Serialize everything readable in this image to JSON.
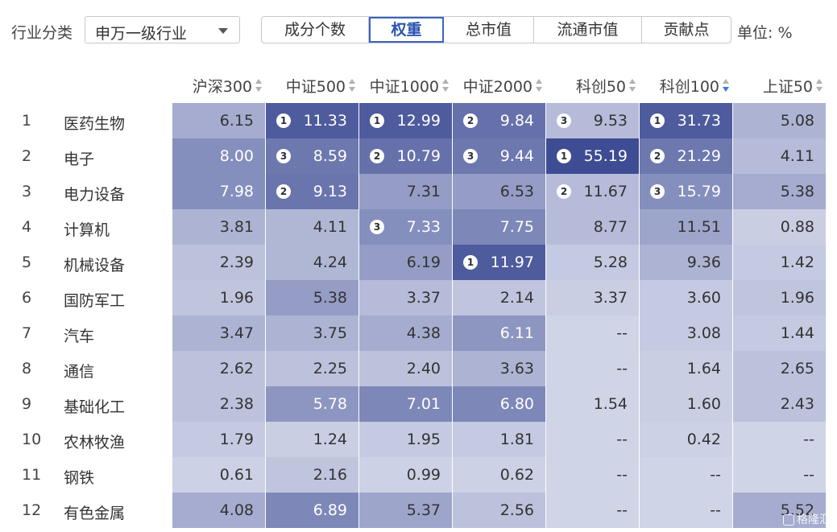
{
  "toolbar": {
    "industry_label": "行业分类",
    "industry_select": "申万一级行业",
    "tabs": [
      {
        "label": "成分个数",
        "active": false
      },
      {
        "label": "权重",
        "active": true
      },
      {
        "label": "总市值",
        "active": false
      },
      {
        "label": "流通市值",
        "active": false
      },
      {
        "label": "贡献点",
        "active": false
      }
    ],
    "unit": "单位: %"
  },
  "columns": [
    "沪深300",
    "中证500",
    "中证1000",
    "中证2000",
    "科创50",
    "科创100",
    "上证50"
  ],
  "sorted_column": "科创100",
  "rows": [
    {
      "rank": "1",
      "name": "医药生物",
      "cells": [
        {
          "v": "6.15",
          "f": 0.35
        },
        {
          "v": "11.33",
          "b": "1",
          "f": 0.9
        },
        {
          "v": "12.99",
          "b": "1",
          "f": 0.9
        },
        {
          "v": "9.84",
          "b": "2",
          "f": 0.75
        },
        {
          "v": "9.53",
          "b": "3",
          "f": 0.25
        },
        {
          "v": "31.73",
          "b": "1",
          "f": 0.9
        },
        {
          "v": "5.08",
          "f": 0.3
        }
      ]
    },
    {
      "rank": "2",
      "name": "电子",
      "cells": [
        {
          "v": "8.00",
          "f": 0.55
        },
        {
          "v": "8.59",
          "b": "3",
          "f": 0.7
        },
        {
          "v": "10.79",
          "b": "2",
          "f": 0.75
        },
        {
          "v": "9.44",
          "b": "3",
          "f": 0.7
        },
        {
          "v": "55.19",
          "b": "1",
          "f": 1.0
        },
        {
          "v": "21.29",
          "b": "2",
          "f": 0.7
        },
        {
          "v": "4.11",
          "f": 0.25
        }
      ]
    },
    {
      "rank": "3",
      "name": "电力设备",
      "cells": [
        {
          "v": "7.98",
          "f": 0.55
        },
        {
          "v": "9.13",
          "b": "2",
          "f": 0.72
        },
        {
          "v": "7.31",
          "f": 0.45
        },
        {
          "v": "6.53",
          "f": 0.45
        },
        {
          "v": "11.67",
          "b": "2",
          "f": 0.25
        },
        {
          "v": "15.79",
          "b": "3",
          "f": 0.55
        },
        {
          "v": "5.38",
          "f": 0.35
        }
      ]
    },
    {
      "rank": "4",
      "name": "计算机",
      "cells": [
        {
          "v": "3.81",
          "f": 0.3
        },
        {
          "v": "4.11",
          "f": 0.28
        },
        {
          "v": "7.33",
          "b": "3",
          "f": 0.55
        },
        {
          "v": "7.75",
          "f": 0.6
        },
        {
          "v": "8.77",
          "f": 0.25
        },
        {
          "v": "11.51",
          "f": 0.4
        },
        {
          "v": "0.88",
          "f": 0.12
        }
      ]
    },
    {
      "rank": "5",
      "name": "机械设备",
      "cells": [
        {
          "v": "2.39",
          "f": 0.2
        },
        {
          "v": "4.24",
          "f": 0.28
        },
        {
          "v": "6.19",
          "f": 0.45
        },
        {
          "v": "11.97",
          "b": "1",
          "f": 0.9
        },
        {
          "v": "5.28",
          "f": 0.15
        },
        {
          "v": "9.36",
          "f": 0.3
        },
        {
          "v": "1.42",
          "f": 0.15
        }
      ]
    },
    {
      "rank": "6",
      "name": "国防军工",
      "cells": [
        {
          "v": "1.96",
          "f": 0.18
        },
        {
          "v": "5.38",
          "f": 0.45
        },
        {
          "v": "3.37",
          "f": 0.25
        },
        {
          "v": "2.14",
          "f": 0.18
        },
        {
          "v": "3.37",
          "f": 0.12
        },
        {
          "v": "3.60",
          "f": 0.15
        },
        {
          "v": "1.96",
          "f": 0.18
        }
      ]
    },
    {
      "rank": "7",
      "name": "汽车",
      "cells": [
        {
          "v": "3.47",
          "f": 0.3
        },
        {
          "v": "3.75",
          "f": 0.3
        },
        {
          "v": "4.38",
          "f": 0.35
        },
        {
          "v": "6.11",
          "f": 0.5
        },
        {
          "v": "--",
          "f": 0.08
        },
        {
          "v": "3.08",
          "f": 0.15
        },
        {
          "v": "1.44",
          "f": 0.15
        }
      ]
    },
    {
      "rank": "8",
      "name": "通信",
      "cells": [
        {
          "v": "2.62",
          "f": 0.2
        },
        {
          "v": "2.25",
          "f": 0.2
        },
        {
          "v": "2.40",
          "f": 0.2
        },
        {
          "v": "3.63",
          "f": 0.3
        },
        {
          "v": "--",
          "f": 0.08
        },
        {
          "v": "1.64",
          "f": 0.12
        },
        {
          "v": "2.65",
          "f": 0.2
        }
      ]
    },
    {
      "rank": "9",
      "name": "基础化工",
      "cells": [
        {
          "v": "2.38",
          "f": 0.2
        },
        {
          "v": "5.78",
          "f": 0.5
        },
        {
          "v": "7.01",
          "f": 0.6
        },
        {
          "v": "6.80",
          "f": 0.6
        },
        {
          "v": "1.54",
          "f": 0.08
        },
        {
          "v": "1.60",
          "f": 0.12
        },
        {
          "v": "2.43",
          "f": 0.2
        }
      ]
    },
    {
      "rank": "10",
      "name": "农林牧渔",
      "cells": [
        {
          "v": "1.79",
          "f": 0.15
        },
        {
          "v": "1.24",
          "f": 0.12
        },
        {
          "v": "1.95",
          "f": 0.15
        },
        {
          "v": "1.81",
          "f": 0.15
        },
        {
          "v": "--",
          "f": 0.08
        },
        {
          "v": "0.42",
          "f": 0.1
        },
        {
          "v": "--",
          "f": 0.08
        }
      ]
    },
    {
      "rank": "11",
      "name": "钢铁",
      "cells": [
        {
          "v": "0.61",
          "f": 0.1
        },
        {
          "v": "2.16",
          "f": 0.18
        },
        {
          "v": "0.99",
          "f": 0.1
        },
        {
          "v": "0.62",
          "f": 0.1
        },
        {
          "v": "--",
          "f": 0.08
        },
        {
          "v": "--",
          "f": 0.08
        },
        {
          "v": "--",
          "f": 0.08
        }
      ]
    },
    {
      "rank": "12",
      "name": "有色金属",
      "cells": [
        {
          "v": "4.08",
          "f": 0.35
        },
        {
          "v": "6.89",
          "f": 0.6
        },
        {
          "v": "5.37",
          "f": 0.4
        },
        {
          "v": "2.56",
          "f": 0.2
        },
        {
          "v": "--",
          "f": 0.08
        },
        {
          "v": "--",
          "f": 0.08
        },
        {
          "v": "5.52",
          "f": 0.35
        }
      ]
    }
  ],
  "badge_glyphs": {
    "1": "1",
    "2": "2",
    "3": "3"
  },
  "watermark": "格隆汇"
}
